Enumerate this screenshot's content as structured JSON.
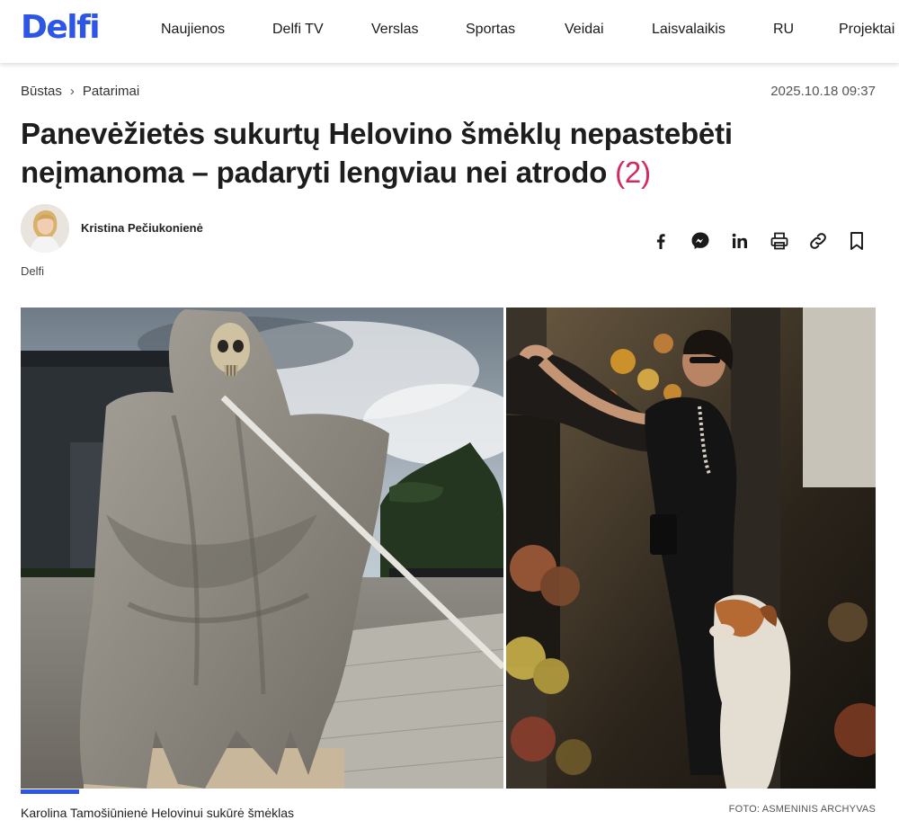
{
  "brand": {
    "logo": "Delfi",
    "accent": "#2d55e6"
  },
  "nav": {
    "items": [
      "Naujienos",
      "Delfi TV",
      "Verslas",
      "Sportas",
      "Veidai",
      "Laisvalaikis",
      "RU",
      "Projektai"
    ]
  },
  "breadcrumb": {
    "section": "Būstas",
    "separator": "›",
    "subsection": "Patarimai"
  },
  "article": {
    "date": "2025.10.18 09:37",
    "title": "Panevėžietės sukurtų Helovino šmėklų nepastebėti neįmanoma – padaryti lengviau nei atrodo",
    "comment_count": "(2)",
    "comment_color": "#d22a5f",
    "author": "Kristina Pečiukonienė",
    "source": "Delfi"
  },
  "share": {
    "icons": [
      "facebook-icon",
      "messenger-icon",
      "linkedin-icon",
      "print-icon",
      "link-icon",
      "bookmark-icon"
    ]
  },
  "media": {
    "caption": "Karolina Tamošiūnienė Helovinui sukūrė šmėklas",
    "credit": "FOTO: ASMENINIS ARCHYVAS"
  }
}
